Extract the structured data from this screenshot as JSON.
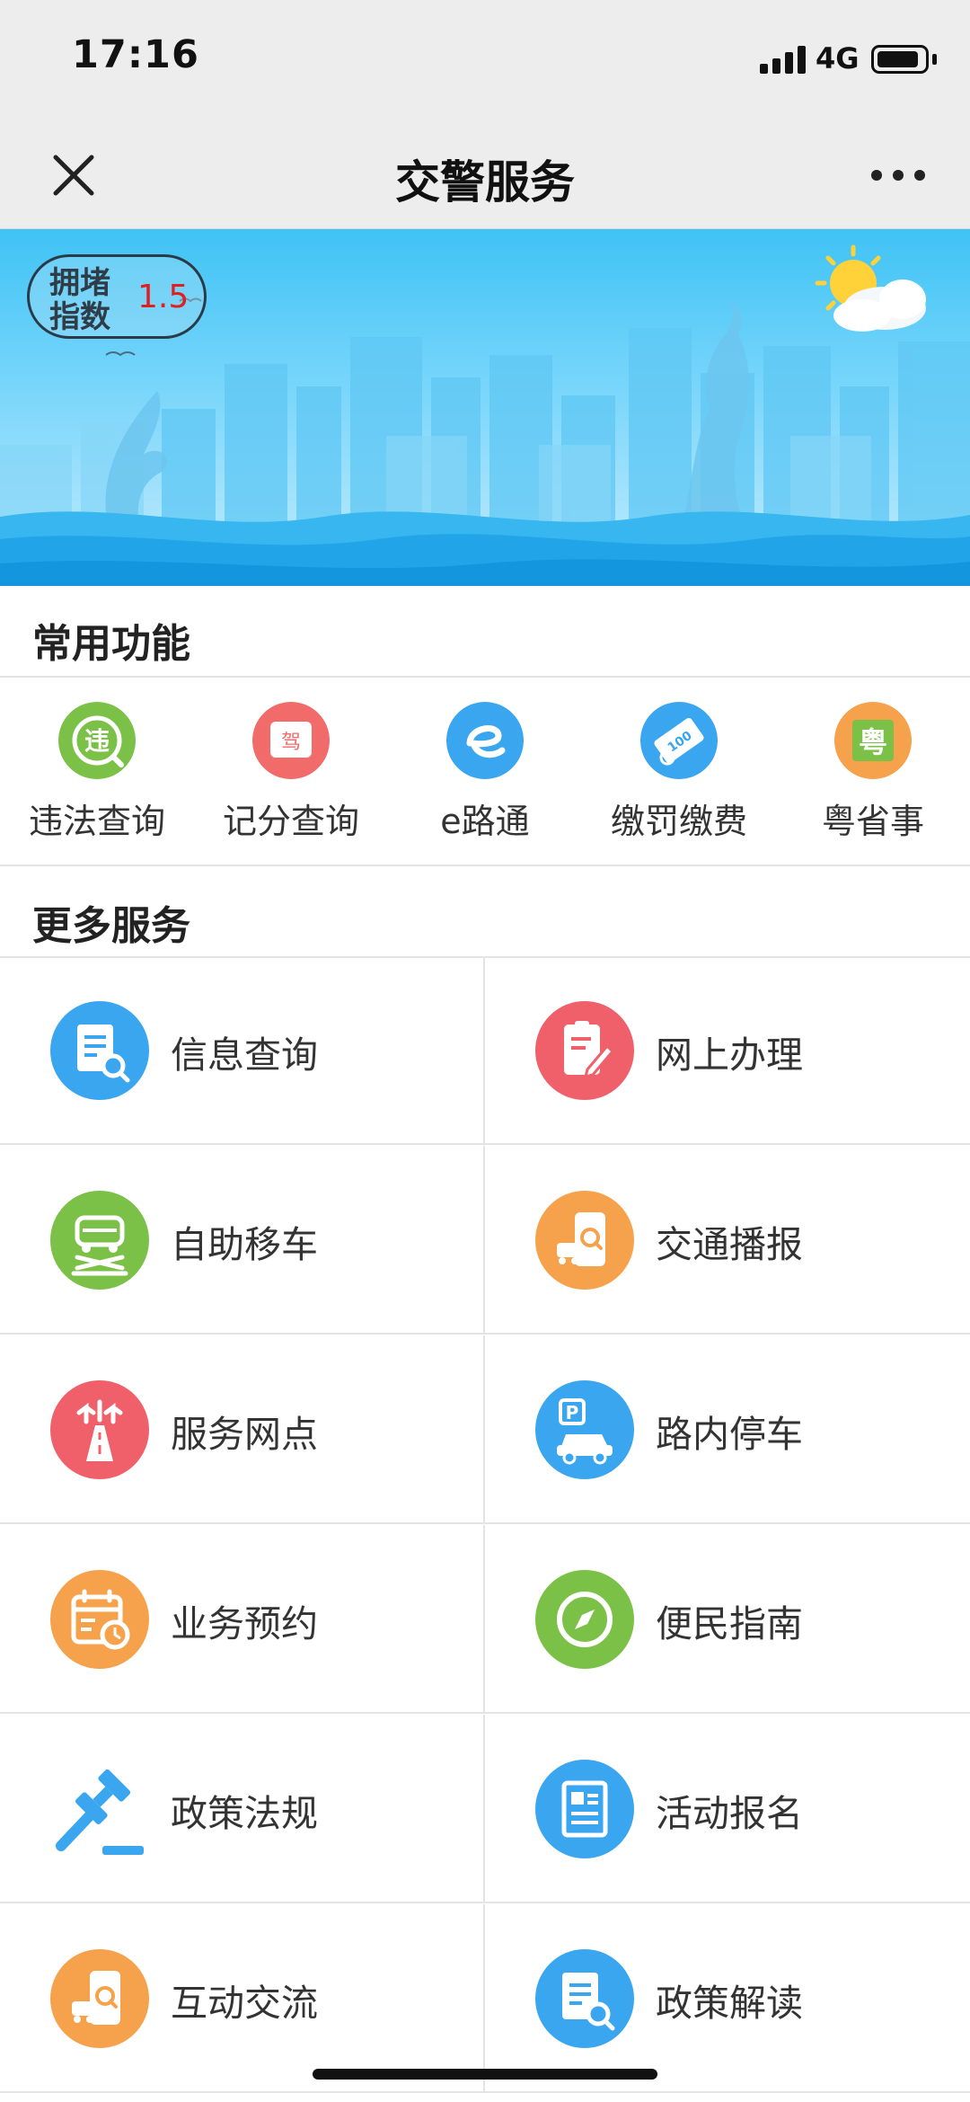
{
  "status_bar": {
    "time": "17:16",
    "network": "4G"
  },
  "nav": {
    "title": "交警服务"
  },
  "banner": {
    "congestion_label": "拥堵指数",
    "congestion_value": "1.5"
  },
  "common": {
    "title": "常用功能",
    "items": [
      {
        "label": "违法查询",
        "icon": "violation-query-icon",
        "color": "#7cc147",
        "glyph": "违"
      },
      {
        "label": "记分查询",
        "icon": "points-query-icon",
        "color": "#f26b6b",
        "glyph": "驾"
      },
      {
        "label": "e路通",
        "icon": "e-road-icon",
        "color": "#3aa6ef",
        "glyph": "e"
      },
      {
        "label": "缴罚缴费",
        "icon": "fine-payment-icon",
        "color": "#3aa6ef",
        "glyph": "100"
      },
      {
        "label": "粤省事",
        "icon": "yue-shengshi-icon",
        "color": "#f6a24c",
        "glyph": "粤"
      }
    ]
  },
  "more": {
    "title": "更多服务",
    "items": [
      {
        "label": "信息查询",
        "icon": "info-query-icon",
        "color": "#3aa6ef"
      },
      {
        "label": "网上办理",
        "icon": "online-handling-icon",
        "color": "#f0606a"
      },
      {
        "label": "自助移车",
        "icon": "self-move-car-icon",
        "color": "#7cc147"
      },
      {
        "label": "交通播报",
        "icon": "traffic-broadcast-icon",
        "color": "#f6a24c"
      },
      {
        "label": "服务网点",
        "icon": "service-outlet-icon",
        "color": "#f0606a"
      },
      {
        "label": "路内停车",
        "icon": "street-parking-icon",
        "color": "#3aa6ef"
      },
      {
        "label": "业务预约",
        "icon": "appointment-icon",
        "color": "#f6a24c"
      },
      {
        "label": "便民指南",
        "icon": "compass-guide-icon",
        "color": "#7cc147"
      },
      {
        "label": "政策法规",
        "icon": "gavel-icon",
        "color": "#3aa6ef"
      },
      {
        "label": "活动报名",
        "icon": "activity-signup-icon",
        "color": "#3aa6ef"
      },
      {
        "label": "互动交流",
        "icon": "interaction-icon",
        "color": "#f6a24c"
      },
      {
        "label": "政策解读",
        "icon": "policy-interpret-icon",
        "color": "#3aa6ef"
      }
    ]
  }
}
